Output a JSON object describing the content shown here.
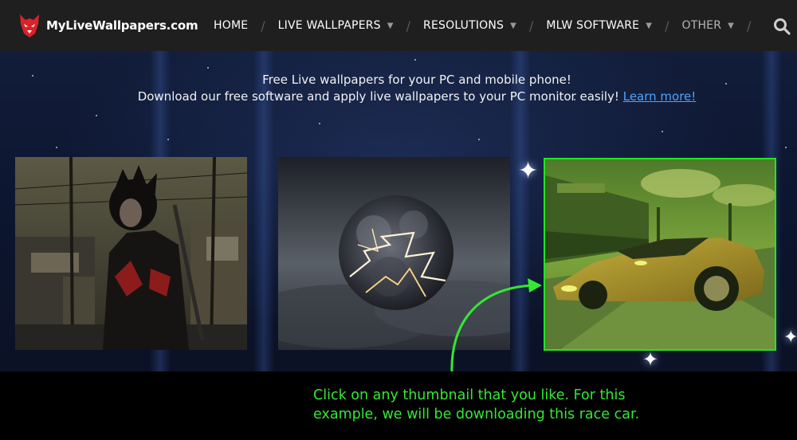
{
  "site": {
    "logo_text": "MyLiveWallpapers.com"
  },
  "nav": {
    "items": [
      {
        "label": "HOME",
        "has_dropdown": false
      },
      {
        "label": "LIVE WALLPAPERS",
        "has_dropdown": true
      },
      {
        "label": "RESOLUTIONS",
        "has_dropdown": true
      },
      {
        "label": "MLW SOFTWARE",
        "has_dropdown": true
      },
      {
        "label": "OTHER",
        "has_dropdown": true
      }
    ],
    "search_icon": "search-icon"
  },
  "intro": {
    "line1": "Free Live wallpapers for your PC and mobile phone!",
    "line2": "Download our free software and apply live wallpapers to your PC monitor easily!",
    "link_text": "Learn more!"
  },
  "thumbnails": [
    {
      "id": "thumbnail-anime-samurai",
      "highlighted": false
    },
    {
      "id": "thumbnail-storm-planet",
      "highlighted": false
    },
    {
      "id": "thumbnail-race-car",
      "highlighted": true
    }
  ],
  "instruction": {
    "line1": "Click on any thumbnail that you like. For this",
    "line2": "example, we will be downloading this race car."
  },
  "colors": {
    "nav_bg": "#1f1f1f",
    "link": "#4da3ff",
    "highlight": "#1fe81f",
    "instruction_text": "#33e833"
  }
}
